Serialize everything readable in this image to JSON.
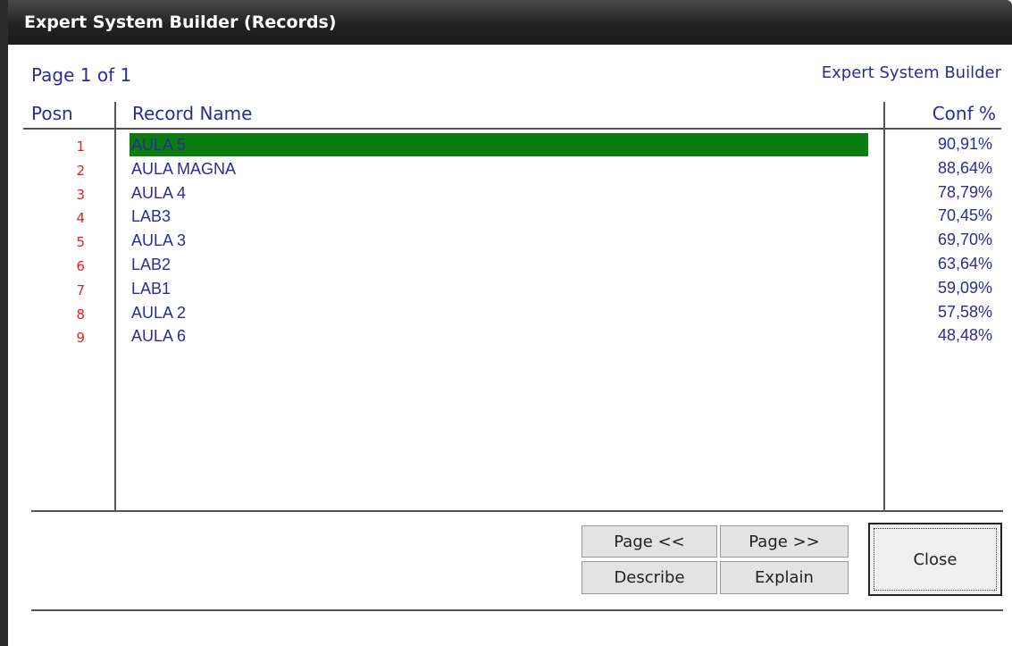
{
  "window": {
    "title": "Expert System Builder (Records)"
  },
  "header": {
    "page_info": "Page 1 of 1",
    "app_name": "Expert System Builder"
  },
  "columns": {
    "posn": "Posn",
    "record_name": "Record Name",
    "conf": "Conf %"
  },
  "records": [
    {
      "posn": "1",
      "name": "AULA 5",
      "conf": "90,91%",
      "selected": true
    },
    {
      "posn": "2",
      "name": "AULA MAGNA",
      "conf": "88,64%",
      "selected": false
    },
    {
      "posn": "3",
      "name": "AULA 4",
      "conf": "78,79%",
      "selected": false
    },
    {
      "posn": "4",
      "name": "LAB3",
      "conf": "70,45%",
      "selected": false
    },
    {
      "posn": "5",
      "name": "AULA 3",
      "conf": "69,70%",
      "selected": false
    },
    {
      "posn": "6",
      "name": "LAB2",
      "conf": "63,64%",
      "selected": false
    },
    {
      "posn": "7",
      "name": "LAB1",
      "conf": "59,09%",
      "selected": false
    },
    {
      "posn": "8",
      "name": "AULA 2",
      "conf": "57,58%",
      "selected": false
    },
    {
      "posn": "9",
      "name": "AULA 6",
      "conf": "48,48%",
      "selected": false
    }
  ],
  "buttons": {
    "page_prev": "Page <<",
    "page_next": "Page >>",
    "describe": "Describe",
    "explain": "Explain",
    "close": "Close"
  },
  "colors": {
    "accent_text": "#2b2b9a",
    "position_text": "#e02020",
    "selection": "#0a7d10",
    "title_bar": "#222222"
  }
}
